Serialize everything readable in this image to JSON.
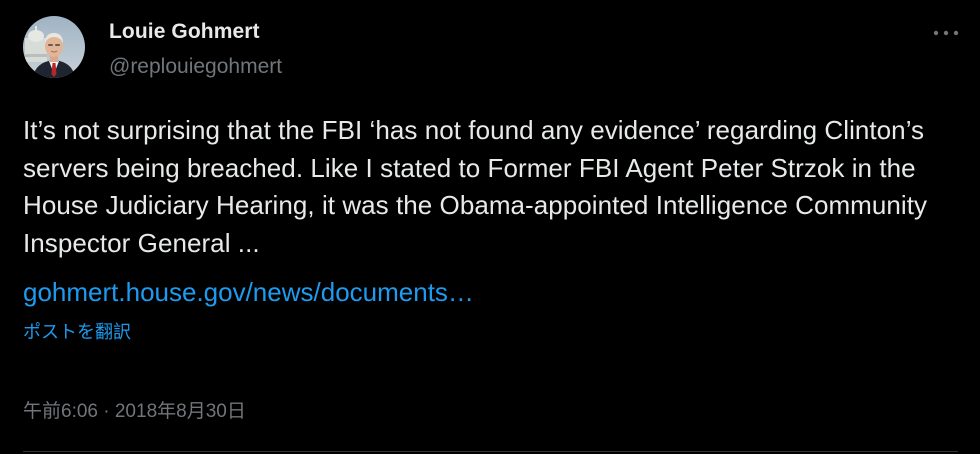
{
  "author": {
    "display_name": "Louie Gohmert",
    "handle": "@replouiegohmert"
  },
  "tweet": {
    "text": "It’s not surprising that the FBI ‘has not found any evidence’ regarding Clinton’s servers being breached. Like I stated to Former FBI Agent Peter Strzok in the House Judiciary Hearing, it was the Obama-appointed Intelligence Community Inspector General ...",
    "link_text": "gohmert.house.gov/news/documents…",
    "translate_label": "ポストを翻訳",
    "timestamp": "午前6:06 · 2018年8月30日"
  },
  "icons": {
    "avatar": "profile-photo",
    "more": "more-horizontal-icon"
  },
  "colors": {
    "background": "#000000",
    "primary_text": "#e7e9ea",
    "secondary_text": "#71767b",
    "link": "#1d9bf0",
    "divider": "#2f3336"
  }
}
